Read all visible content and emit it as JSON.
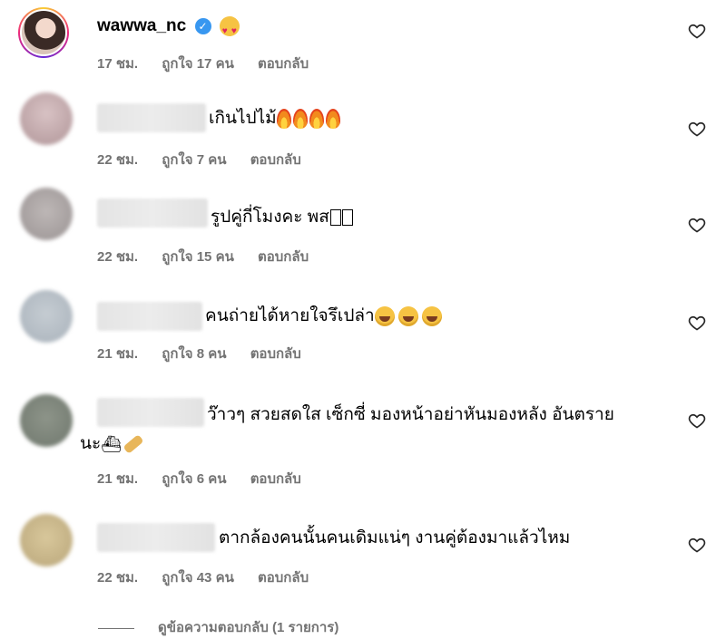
{
  "comments": [
    {
      "user": "wawwa_nc",
      "verified": true,
      "text": "",
      "emoji": "heart-eyes",
      "time": "17 ชม.",
      "likes": "ถูกใจ 17 คน",
      "reply": "ตอบกลับ"
    },
    {
      "text": "เกินไปไม้",
      "emoji": "fire x4",
      "time": "22 ชม.",
      "likes": "ถูกใจ 7 คน",
      "reply": "ตอบกลับ"
    },
    {
      "text": "รูปคู่กี่โมงคะ พส",
      "time": "22 ชม.",
      "likes": "ถูกใจ 15 คน",
      "reply": "ตอบกลับ"
    },
    {
      "text": "คนถ่ายได้หายใจรึเปล่า",
      "emoji": "laugh x3",
      "time": "21 ชม.",
      "likes": "ถูกใจ 8 คน",
      "reply": "ตอบกลับ"
    },
    {
      "text": "ว๊าวๆ สวยสดใส เซ็กซี่ มองหน้าอย่าหันมองหลัง อันตราย",
      "text2": "นะ",
      "emoji": "ship + bandage",
      "time": "21 ชม.",
      "likes": "ถูกใจ 6 คน",
      "reply": "ตอบกลับ"
    },
    {
      "text": "ตากล้องคนนั้นคนเดิมแน่ๆ งานคู่ต้องมาแล้วไหม",
      "time": "22 ชม.",
      "likes": "ถูกใจ 43 คน",
      "reply": "ตอบกลับ"
    }
  ],
  "view_replies": "ดูข้อความตอบกลับ (1 รายการ)"
}
